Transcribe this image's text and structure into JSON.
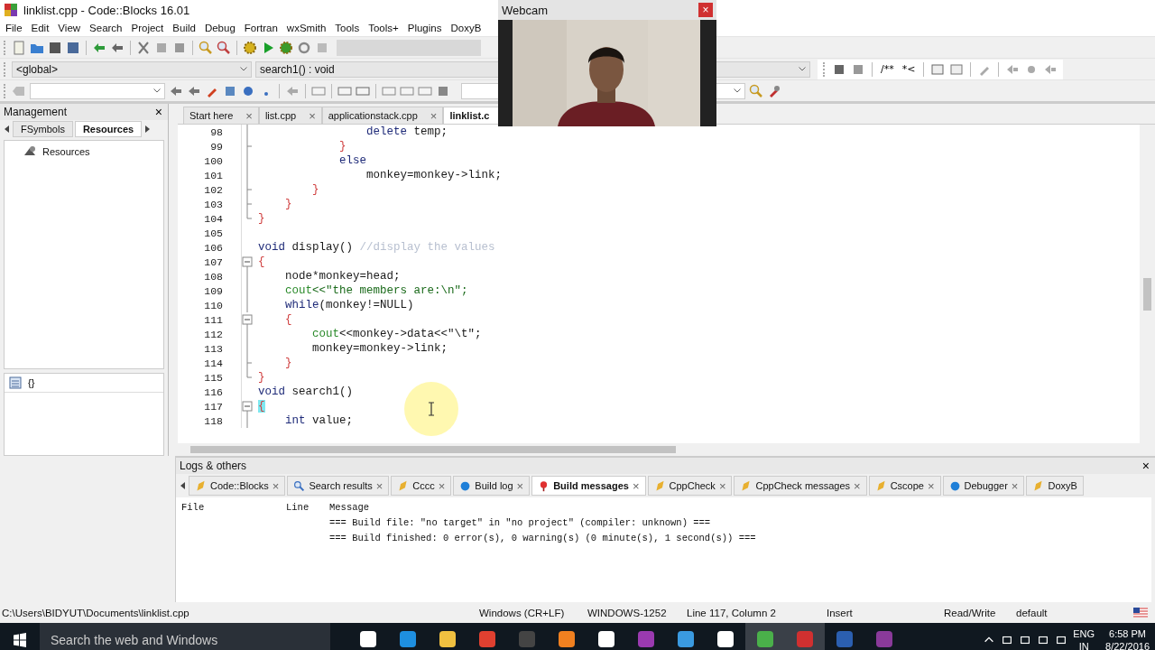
{
  "window": {
    "title": "linklist.cpp - Code::Blocks 16.01"
  },
  "menu": [
    "File",
    "Edit",
    "View",
    "Search",
    "Project",
    "Build",
    "Debug",
    "Fortran",
    "wxSmith",
    "Tools",
    "Tools+",
    "Plugins",
    "DoxyB"
  ],
  "toolbar": {
    "scope": "<global>",
    "function": "search1() : void",
    "doc_comment_buttons": [
      "/**",
      "*<"
    ]
  },
  "management": {
    "title": "Management",
    "close": "×",
    "tabs": [
      {
        "label": "FSymbols",
        "selected": false
      },
      {
        "label": "Resources",
        "selected": true
      }
    ],
    "tree": [
      {
        "label": "Resources"
      }
    ],
    "symbols_button": "{}"
  },
  "editor": {
    "tabs": [
      {
        "label": "Start here",
        "selected": false,
        "close": "×"
      },
      {
        "label": "list.cpp",
        "selected": false,
        "close": "×"
      },
      {
        "label": "applicationstack.cpp",
        "selected": false,
        "close": "×"
      },
      {
        "label": "linklist.c",
        "selected": true
      }
    ],
    "lines": [
      {
        "n": "98",
        "kind": "mid",
        "tokens": [
          {
            "kind": "kw",
            "text": "                delete"
          },
          {
            "kind": "plain",
            "text": " temp;"
          }
        ]
      },
      {
        "n": "99",
        "kind": "end",
        "tokens": [
          {
            "kind": "brace",
            "text": "            }"
          }
        ]
      },
      {
        "n": "100",
        "kind": "mid",
        "tokens": [
          {
            "kind": "kw",
            "text": "            else"
          }
        ]
      },
      {
        "n": "101",
        "kind": "mid",
        "tokens": [
          {
            "kind": "plain",
            "text": "                monkey=monkey->link;"
          }
        ]
      },
      {
        "n": "102",
        "kind": "end",
        "tokens": [
          {
            "kind": "brace",
            "text": "        }"
          }
        ]
      },
      {
        "n": "103",
        "kind": "end",
        "tokens": [
          {
            "kind": "brace",
            "text": "    }"
          }
        ]
      },
      {
        "n": "104",
        "kind": "last",
        "tokens": [
          {
            "kind": "brace",
            "text": "}"
          }
        ]
      },
      {
        "n": "105",
        "kind": "none"
      },
      {
        "n": "106",
        "kind": "none",
        "tokens": [
          {
            "kind": "kw",
            "text": "void"
          },
          {
            "kind": "plain",
            "text": " display() "
          },
          {
            "kind": "comment",
            "text": "//display the values"
          }
        ]
      },
      {
        "n": "107",
        "kind": "open",
        "tokens": [
          {
            "kind": "brace",
            "text": "{"
          }
        ]
      },
      {
        "n": "108",
        "kind": "mid",
        "tokens": [
          {
            "kind": "plain",
            "text": "    node*monkey=head;"
          }
        ]
      },
      {
        "n": "109",
        "kind": "mid",
        "tokens": [
          {
            "kind": "stream",
            "text": "    cout"
          },
          {
            "kind": "str",
            "text": "<<\"the members are:\\n\";"
          }
        ]
      },
      {
        "n": "110",
        "kind": "mid",
        "tokens": [
          {
            "kind": "kw",
            "text": "    while"
          },
          {
            "kind": "plain",
            "text": "(monkey!=NULL)"
          }
        ]
      },
      {
        "n": "111",
        "kind": "open",
        "tokens": [
          {
            "kind": "brace",
            "text": "    {"
          }
        ]
      },
      {
        "n": "112",
        "kind": "mid",
        "tokens": [
          {
            "kind": "stream",
            "text": "        cout"
          },
          {
            "kind": "plain",
            "text": "<<monkey->data<<\"\\t\";"
          }
        ]
      },
      {
        "n": "113",
        "kind": "mid",
        "tokens": [
          {
            "kind": "plain",
            "text": "        monkey=monkey->link;"
          }
        ]
      },
      {
        "n": "114",
        "kind": "end",
        "tokens": [
          {
            "kind": "brace",
            "text": "    }"
          }
        ]
      },
      {
        "n": "115",
        "kind": "last",
        "tokens": [
          {
            "kind": "brace",
            "text": "}"
          }
        ]
      },
      {
        "n": "116",
        "kind": "none",
        "tokens": [
          {
            "kind": "kw",
            "text": "void"
          },
          {
            "kind": "plain",
            "text": " search1()"
          }
        ]
      },
      {
        "n": "117",
        "kind": "open",
        "tokens": [
          {
            "kind": "match",
            "text": "{"
          }
        ]
      },
      {
        "n": "118",
        "kind": "mid",
        "tokens": [
          {
            "kind": "kw",
            "text": "    int"
          },
          {
            "kind": "plain",
            "text": " value;"
          }
        ]
      }
    ]
  },
  "webcam": {
    "title": "Webcam",
    "close": "×"
  },
  "logs": {
    "title": "Logs & others",
    "close": "×",
    "tabs": [
      {
        "label": "Code::Blocks",
        "selected": false,
        "close": "×"
      },
      {
        "label": "Search results",
        "selected": false,
        "close": "×"
      },
      {
        "label": "Cccc",
        "selected": false,
        "close": "×"
      },
      {
        "label": "Build log",
        "selected": false,
        "close": "×"
      },
      {
        "label": "Build messages",
        "selected": true,
        "close": "×"
      },
      {
        "label": "CppCheck",
        "selected": false,
        "close": "×"
      },
      {
        "label": "CppCheck messages",
        "selected": false,
        "close": "×"
      },
      {
        "label": "Cscope",
        "selected": false,
        "close": "×"
      },
      {
        "label": "Debugger",
        "selected": false,
        "close": "×"
      },
      {
        "label": "DoxyB",
        "selected": false
      }
    ],
    "columns": [
      "File",
      "Line",
      "Message"
    ],
    "rows": [
      {
        "message": "=== Build file: \"no target\" in \"no project\" (compiler: unknown) ==="
      },
      {
        "message": "=== Build finished: 0 error(s), 0 warning(s) (0 minute(s), 1 second(s)) ==="
      }
    ]
  },
  "status_bar": [
    "C:\\Users\\BIDYUT\\Documents\\linklist.cpp",
    "Windows (CR+LF)",
    "WINDOWS-1252",
    "Line 117, Column 2",
    "Insert",
    "Read/Write",
    "default"
  ],
  "taskbar": {
    "search": "Search the web and Windows",
    "language": "ENG",
    "region": "IN",
    "time": "6:58 PM",
    "date": "8/22/2016"
  }
}
